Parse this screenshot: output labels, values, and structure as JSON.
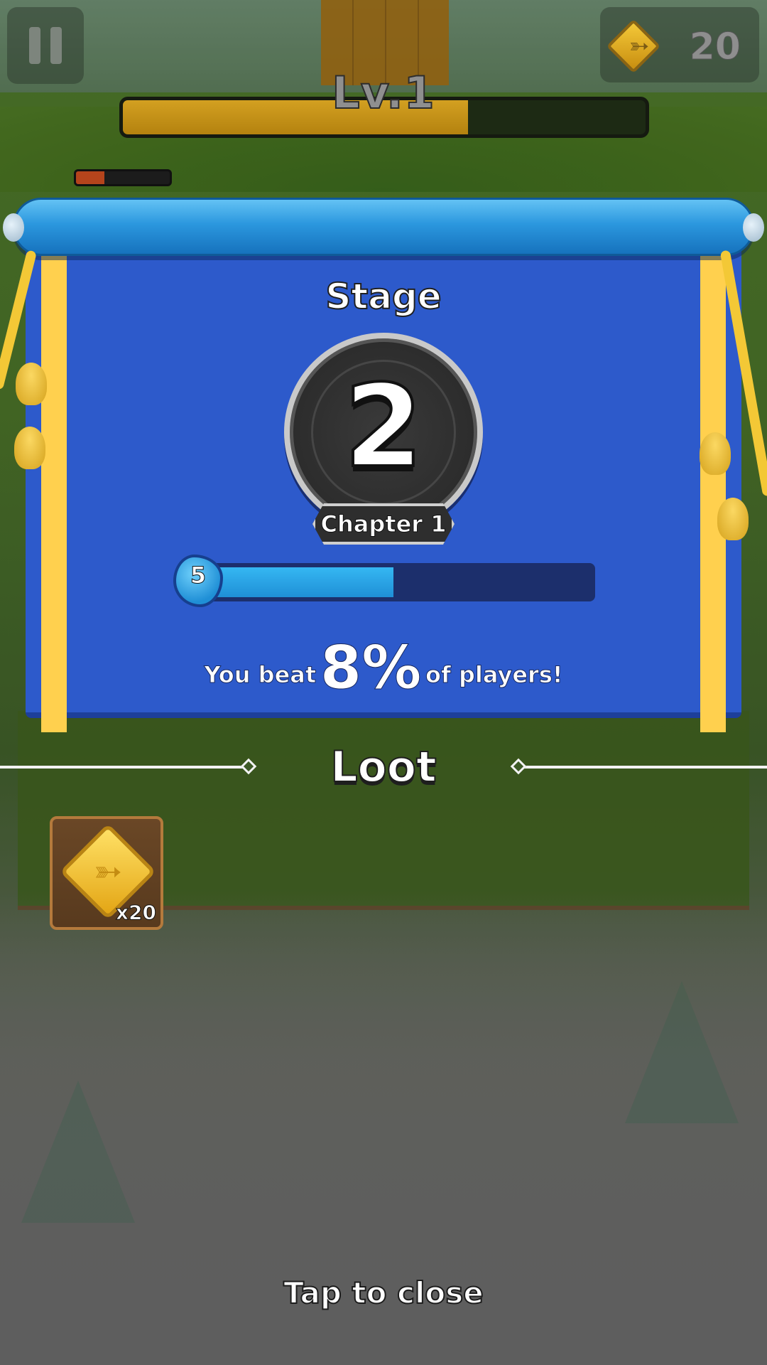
{
  "hud": {
    "currency_count": "20",
    "currency_icon": "bow-gem-icon",
    "level_label": "Lv.1",
    "xp_progress": 0.66,
    "enemy_health": 0.3
  },
  "result": {
    "stage_title": "Stage",
    "stage_number": "2",
    "chapter_label": "Chapter 1",
    "player_level": "5",
    "player_progress": 0.5,
    "beat_prefix": "You beat",
    "beat_percent": "8%",
    "beat_suffix": "of players!"
  },
  "loot": {
    "title": "Loot",
    "items": [
      {
        "icon": "bow-gem-icon",
        "quantity": "x20"
      }
    ]
  },
  "footer": {
    "tap_to_close": "Tap to close"
  },
  "colors": {
    "banner": "#2d5acb",
    "banner_stripe": "#ffd04e",
    "xp_fill": "#d3a021",
    "progress_fill": "#35b7f2"
  }
}
